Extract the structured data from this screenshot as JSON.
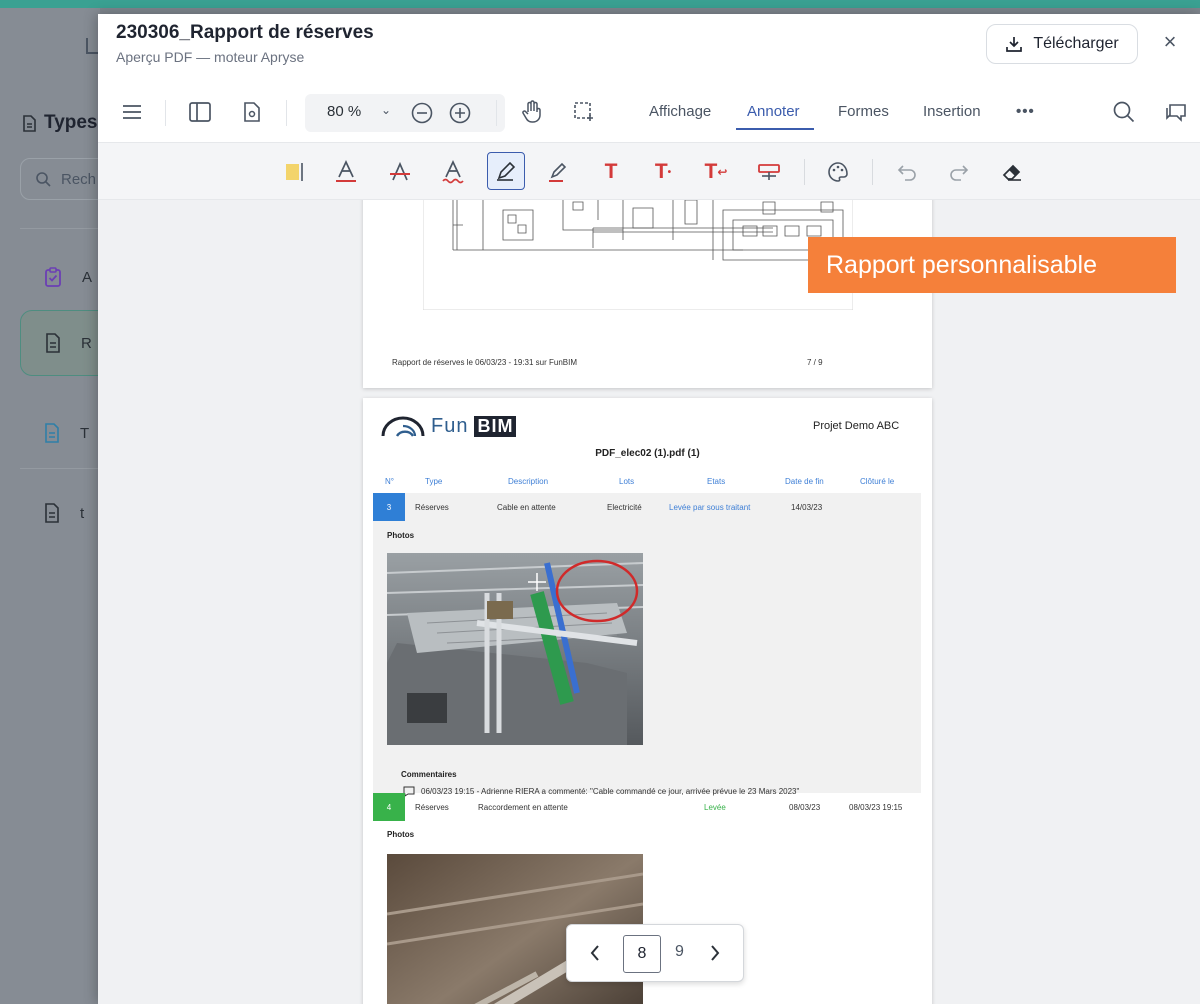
{
  "background_app": {
    "section_title": "Types",
    "search_placeholder": "Rech",
    "items": [
      {
        "label": "A"
      },
      {
        "label": "R"
      },
      {
        "label": "T"
      },
      {
        "label": "t"
      }
    ]
  },
  "modal": {
    "title": "230306_Rapport de réserves",
    "subtitle": "Aperçu PDF — moteur Apryse",
    "download_label": "Télécharger",
    "close_label": "×"
  },
  "toolbar": {
    "zoom": "80 %",
    "tabs": [
      "Affichage",
      "Annoter",
      "Formes",
      "Insertion"
    ],
    "active_tab": "Annoter",
    "more_label": "•••"
  },
  "annotation_tools": [
    {
      "name": "sticky-note",
      "glyph": "▮"
    },
    {
      "name": "underline",
      "glyph": "A"
    },
    {
      "name": "strikeout",
      "glyph": "A"
    },
    {
      "name": "squiggly",
      "glyph": "A"
    },
    {
      "name": "freehand",
      "glyph": "✎"
    },
    {
      "name": "highlight-pen",
      "glyph": "✎"
    },
    {
      "name": "free-text",
      "glyph": "T"
    },
    {
      "name": "text-insert",
      "glyph": "T"
    },
    {
      "name": "text-replace",
      "glyph": "T"
    },
    {
      "name": "callout",
      "glyph": "▭"
    }
  ],
  "badge": {
    "text": "Rapport personnalisable",
    "color": "#f5803a"
  },
  "page7": {
    "footer": "Rapport de réserves le 06/03/23 - 19:31 sur FunBIM",
    "page_num": "7 / 9"
  },
  "page8": {
    "logo_text": "Fun",
    "logo_bim": "BIM",
    "project": "Projet Demo ABC",
    "pdf_name": "PDF_elec02 (1).pdf (1)",
    "headers": [
      "N°",
      "Type",
      "Description",
      "Lots",
      "Etats",
      "Date de fin",
      "Clôturé le"
    ],
    "rows": [
      {
        "num": "3",
        "type": "Réserves",
        "description": "Cable en attente",
        "lot": "Electricité",
        "state": "Levée par sous traitant",
        "end_date": "14/03/23",
        "closed": ""
      },
      {
        "num": "4",
        "type": "Réserves",
        "description": "Raccordement en attente",
        "lot": "",
        "state": "Levée",
        "end_date": "08/03/23",
        "closed": "08/03/23 19:15"
      }
    ],
    "photos_label": "Photos",
    "comments_label": "Commentaires",
    "comment": "06/03/23 19:15 - Adrienne RIERA a commenté: \"Cable commandé ce jour, arrivée prévue le 23 Mars 2023\""
  },
  "pager": {
    "current": "8",
    "total": "9"
  }
}
